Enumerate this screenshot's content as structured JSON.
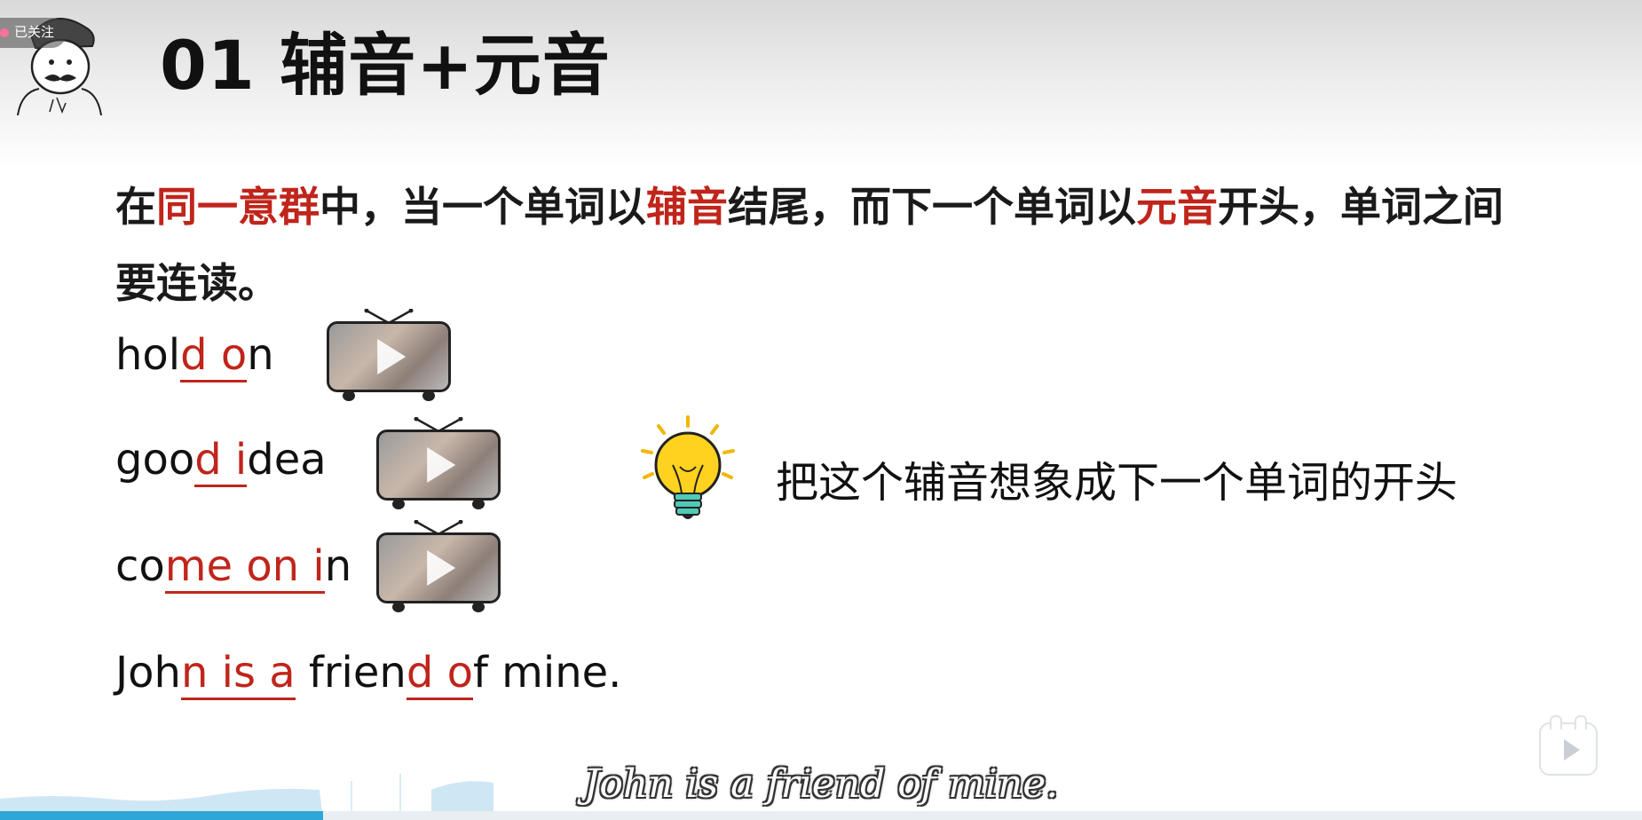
{
  "header": {
    "follow_badge": "已关注",
    "title": "01 辅音+元音"
  },
  "description": {
    "p1": "在",
    "h1": "同一意群",
    "p2": "中，当一个单词以",
    "h2": "辅音",
    "p3": "结尾，而下一个单词以",
    "h3": "元音",
    "p4": "开头，单词之间要连读。"
  },
  "examples": [
    {
      "pre": "hol",
      "hl": "d o",
      "post": "n"
    },
    {
      "pre": "goo",
      "hl": "d i",
      "post": "dea"
    },
    {
      "pre": "co",
      "hl": "me on i",
      "post": "n"
    }
  ],
  "sentence": {
    "a": "Joh",
    "b": "n is a",
    "c": " frien",
    "d": "d o",
    "e": "f mine."
  },
  "tip": "把这个辅音想象成下一个单词的开头",
  "subtitle": "John is a friend of mine.",
  "player": {
    "progress_fraction": 0.197
  },
  "colors": {
    "highlight": "#c0251b",
    "progress": "#2ea7d8"
  }
}
